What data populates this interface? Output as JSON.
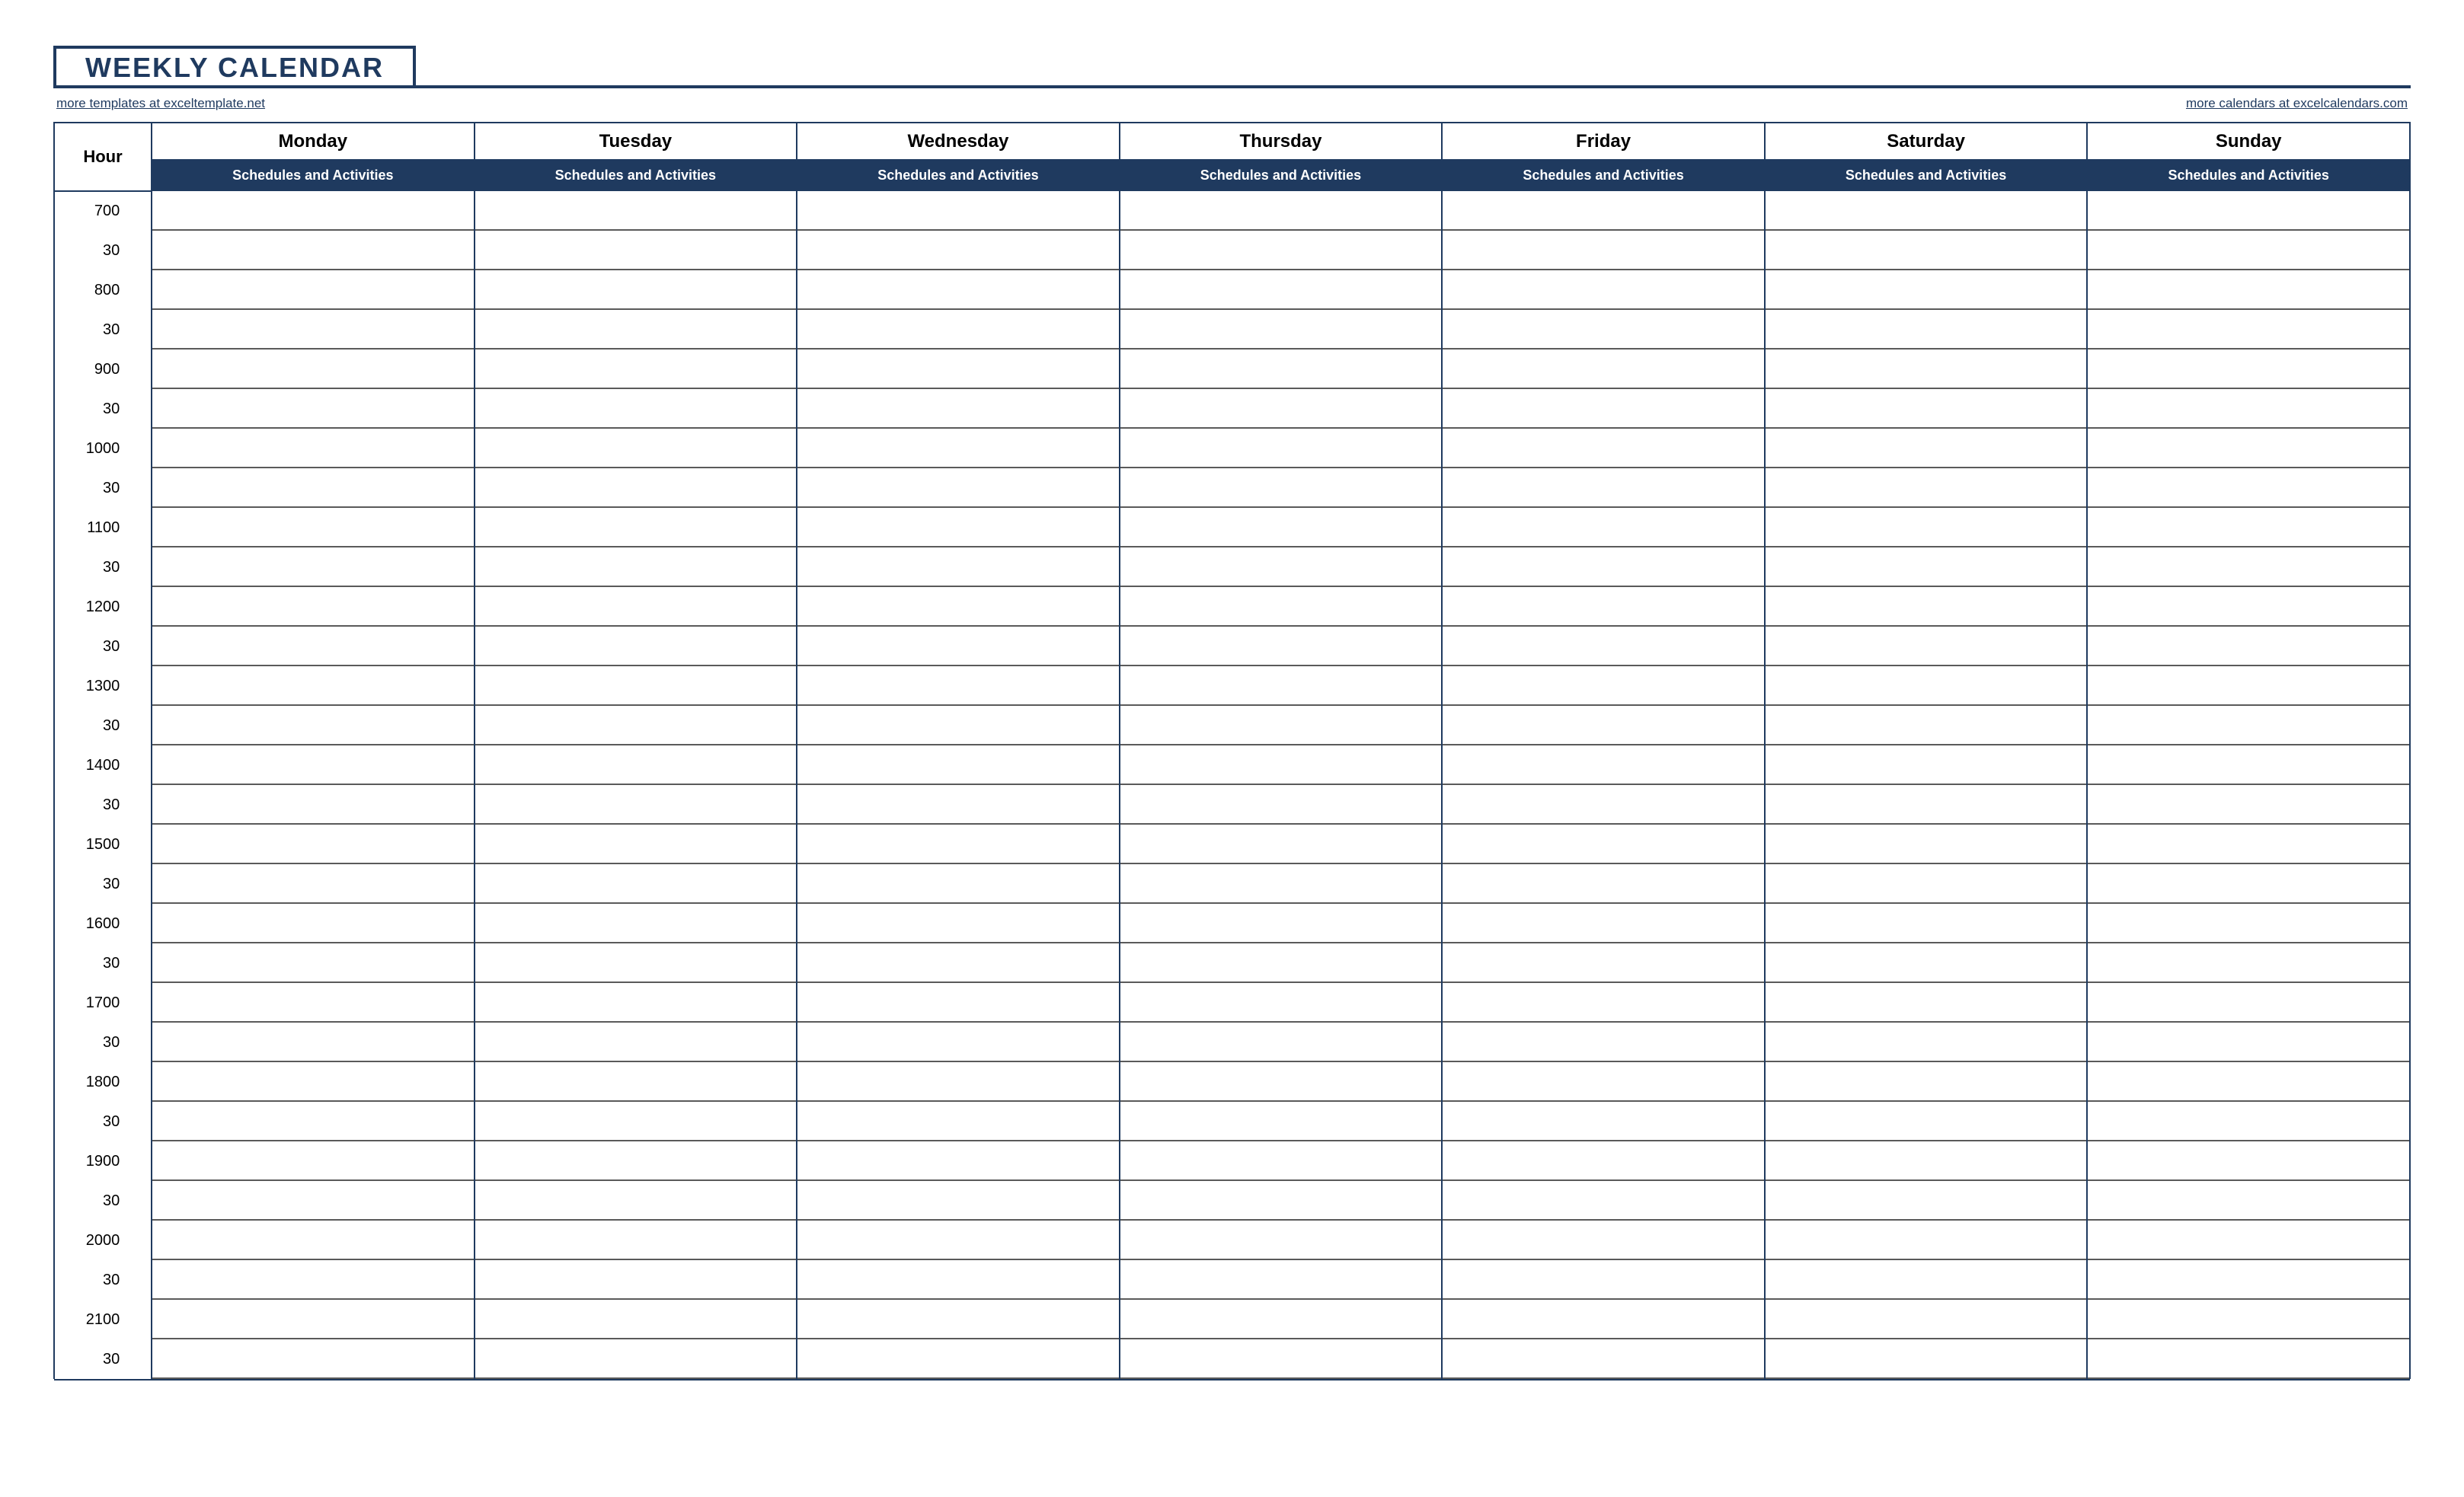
{
  "title": "WEEKLY CALENDAR",
  "links": {
    "left": "more templates at exceltemplate.net",
    "right": "more calendars at excelcalendars.com"
  },
  "header": {
    "hour_label": "Hour",
    "days": [
      "Monday",
      "Tuesday",
      "Wednesday",
      "Thursday",
      "Friday",
      "Saturday",
      "Sunday"
    ],
    "sub_label": "Schedules and Activities"
  },
  "hours": [
    "7",
    "8",
    "9",
    "10",
    "11",
    "12",
    "13",
    "14",
    "15",
    "16",
    "17",
    "18",
    "19",
    "20",
    "21"
  ],
  "minutes": [
    "00",
    "30"
  ]
}
